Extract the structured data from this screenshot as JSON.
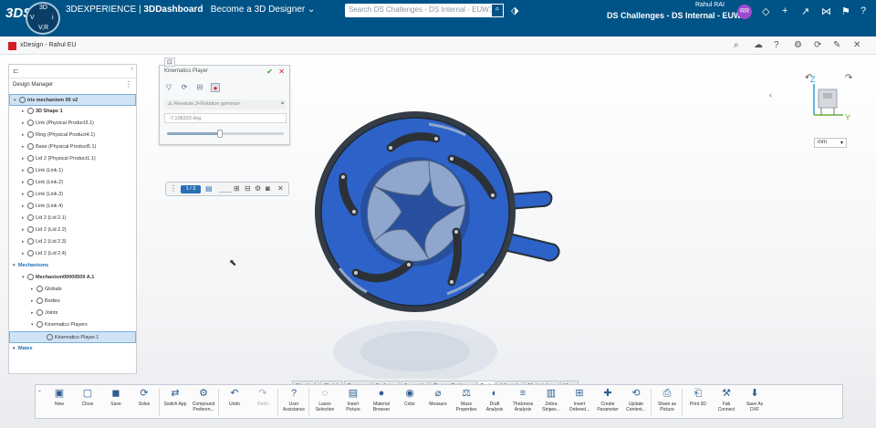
{
  "topbar": {
    "brand": "3DS",
    "compass_labels": {
      "north": "3D",
      "west": "V",
      "east": "i",
      "south": "V,R"
    },
    "app_prefix": "3DEXPERIENCE",
    "app_name": "3DDashboard",
    "dashboard": "Become a 3D Designer",
    "search_placeholder": "Search DS Challenges - DS Internal - EUW1",
    "user_name": "Rahul RAI",
    "tenant": "DS Challenges - DS Internal - EUW1",
    "avatar_initials": "RR"
  },
  "window": {
    "title": "xDesign - Rahul EU"
  },
  "design_manager": {
    "label": "Design Manager",
    "tree": [
      {
        "label": "iris mechanism 05 v2",
        "indent": 0,
        "selected": true,
        "bold": true
      },
      {
        "label": "3D Shape 1",
        "indent": 1,
        "bold": true
      },
      {
        "label": "Link (Physical Product3.1)",
        "indent": 1
      },
      {
        "label": "Ring (Physical Product4.1)",
        "indent": 1
      },
      {
        "label": "Base (Physical Product5.1)",
        "indent": 1
      },
      {
        "label": "Lid 2 (Physical Product1.1)",
        "indent": 1
      },
      {
        "label": "Link (Link.1)",
        "indent": 1
      },
      {
        "label": "Link (Link.2)",
        "indent": 1
      },
      {
        "label": "Link (Link.3)",
        "indent": 1
      },
      {
        "label": "Link (Link.4)",
        "indent": 1
      },
      {
        "label": "Lid 2 (Lid 2.1)",
        "indent": 1
      },
      {
        "label": "Lid 2 (Lid 2.2)",
        "indent": 1
      },
      {
        "label": "Lid 2 (Lid 2.3)",
        "indent": 1
      },
      {
        "label": "Lid 2 (Lid 2.4)",
        "indent": 1
      },
      {
        "label": "Mechanisms",
        "indent": 0,
        "head": true
      },
      {
        "label": "Mechanism00000509 A.1",
        "indent": 1,
        "bold": true
      },
      {
        "label": "Globals",
        "indent": 2
      },
      {
        "label": "Bodies",
        "indent": 2
      },
      {
        "label": "Joints",
        "indent": 2
      },
      {
        "label": "Kinematics Players",
        "indent": 2
      },
      {
        "label": "Kinematics Player.1",
        "indent": 3,
        "selected": true
      },
      {
        "label": "Mates",
        "indent": 0,
        "head": true
      }
    ]
  },
  "kinematics_player": {
    "title": "Kinematics Player",
    "joint_field": "Revolute.3<Rotation gamma>",
    "value_field": "-7.108333 deg",
    "slider_fraction": 0.45
  },
  "step_widget": {
    "badge": "1 / 3"
  },
  "units": {
    "selected": "mm"
  },
  "axis": {
    "z": "Z",
    "y": "Y"
  },
  "tabs": [
    {
      "label": "Standard"
    },
    {
      "label": "Sketch"
    },
    {
      "label": "Features"
    },
    {
      "label": "Surfaces"
    },
    {
      "label": "Assembly"
    },
    {
      "label": "Design Guidance"
    },
    {
      "label": "Tools",
      "active": true
    },
    {
      "label": "Lifecycle"
    },
    {
      "label": "Marketplace"
    },
    {
      "label": "View"
    }
  ],
  "toolbar": [
    {
      "l1": "New",
      "icon": "▣"
    },
    {
      "l1": "Close",
      "icon": "▢"
    },
    {
      "l1": "Save",
      "icon": "◼"
    },
    {
      "l1": "Solve",
      "icon": "⟳"
    },
    {
      "sep": true
    },
    {
      "l1": "Switch App",
      "icon": "⇄"
    },
    {
      "l1": "Compound",
      "l2": "Preferen...",
      "icon": "⚙"
    },
    {
      "sep": true
    },
    {
      "l1": "Undo",
      "icon": "↶"
    },
    {
      "l1": "Redo",
      "icon": "↷",
      "dim": true
    },
    {
      "sep": true
    },
    {
      "l1": "User",
      "l2": "Assistance",
      "icon": "?"
    },
    {
      "sep": true
    },
    {
      "l1": "Lasso",
      "l2": "Selection",
      "icon": "◌"
    },
    {
      "l1": "Insert",
      "l2": "Picture",
      "icon": "▤"
    },
    {
      "l1": "Material",
      "l2": "Browser",
      "icon": "●"
    },
    {
      "l1": "Color",
      "icon": "◉"
    },
    {
      "l1": "Measure",
      "icon": "⌀"
    },
    {
      "l1": "Mass",
      "l2": "Properties",
      "icon": "⚖"
    },
    {
      "l1": "Draft",
      "l2": "Analysis",
      "icon": "◐"
    },
    {
      "l1": "Thickness",
      "l2": "Analysis",
      "icon": "≡"
    },
    {
      "l1": "Zebra",
      "l2": "Stripes...",
      "icon": "▥"
    },
    {
      "l1": "Insert",
      "l2": "Ordered...",
      "icon": "⊞"
    },
    {
      "l1": "Create",
      "l2": "Parameter",
      "icon": "✚"
    },
    {
      "l1": "Update",
      "l2": "Content...",
      "icon": "⟲"
    },
    {
      "sep": true
    },
    {
      "l1": "Share as",
      "l2": "Picture",
      "icon": "⎙"
    },
    {
      "sep": true
    },
    {
      "l1": "Print 3D",
      "icon": "⎗"
    },
    {
      "l1": "Fab",
      "l2": "Connect",
      "icon": "⚒"
    },
    {
      "l1": "Save As",
      "l2": "DXF",
      "icon": "⬇"
    }
  ],
  "colors": {
    "topbar": "#005386",
    "model_blue": "#2d62c9",
    "model_light": "#8fa7cf",
    "model_dark": "#353f48",
    "link": "#1a6fb7"
  }
}
